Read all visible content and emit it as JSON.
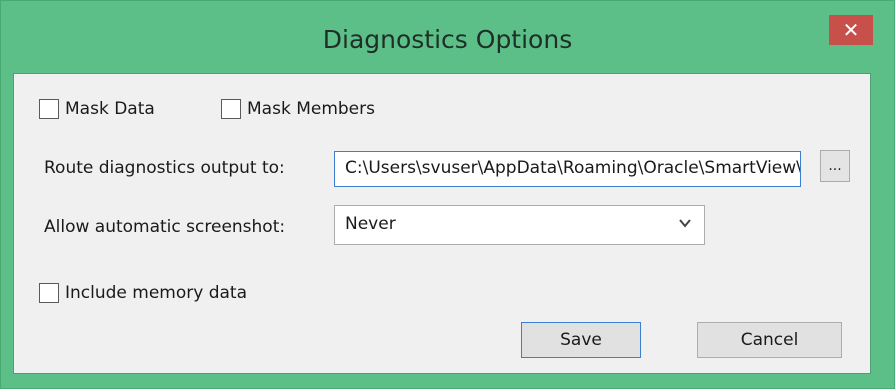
{
  "window": {
    "title": "Diagnostics Options",
    "close_glyph": "✕"
  },
  "options": {
    "mask_data": {
      "label": "Mask Data",
      "checked": false
    },
    "mask_members": {
      "label": "Mask Members",
      "checked": false
    },
    "include_memory": {
      "label": "Include memory data",
      "checked": false
    }
  },
  "route": {
    "label": "Route diagnostics output to:",
    "value": "C:\\Users\\svuser\\AppData\\Roaming\\Oracle\\SmartView\\Diagnostics",
    "browse_label": "..."
  },
  "screenshot": {
    "label": "Allow automatic screenshot:",
    "selected": "Never"
  },
  "buttons": {
    "save": "Save",
    "cancel": "Cancel"
  },
  "colors": {
    "frame": "#5cbf88",
    "close_button": "#c7504a",
    "focus_border": "#3c7fd0"
  }
}
